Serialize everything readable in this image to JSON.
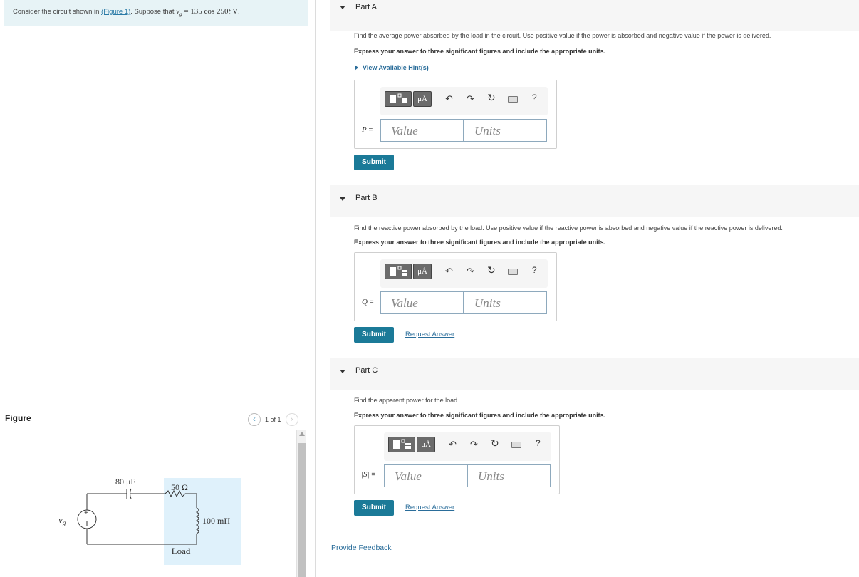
{
  "problem": {
    "prefix": "Consider the circuit shown in ",
    "figure_link": "(Figure 1)",
    "middle": ". Suppose that ",
    "equation": "v_g = 135 cos 250t V",
    "suffix": "."
  },
  "figure": {
    "label": "Figure",
    "pager_text": "1 of 1",
    "circuit": {
      "capacitor": "80 μF",
      "resistor": "50 Ω",
      "inductor": "100 mH",
      "load": "Load",
      "source": "v_g"
    }
  },
  "parts": [
    {
      "title": "Part A",
      "question": "Find the average power absorbed by the load in the circuit. Use positive value if the power is absorbed and negative value if the power is delivered.",
      "instruction": "Express your answer to three significant figures and include the appropriate units.",
      "hint_label": "View Available Hint(s)",
      "variable": "P",
      "value_placeholder": "Value",
      "units_placeholder": "Units",
      "submit_label": "Submit"
    },
    {
      "title": "Part B",
      "question": "Find the reactive power absorbed by the load. Use positive value if the reactive power is absorbed and negative value if the reactive power is delivered.",
      "instruction": "Express your answer to three significant figures and include the appropriate units.",
      "variable": "Q",
      "value_placeholder": "Value",
      "units_placeholder": "Units",
      "submit_label": "Submit",
      "request_label": "Request Answer"
    },
    {
      "title": "Part C",
      "question": "Find the apparent power for the load.",
      "instruction": "Express your answer to three significant figures and include the appropriate units.",
      "variable": "|S|",
      "value_placeholder": "Value",
      "units_placeholder": "Units",
      "submit_label": "Submit",
      "request_label": "Request Answer"
    }
  ],
  "toolbar": {
    "units_button": "μÅ",
    "help": "?"
  },
  "feedback_label": "Provide Feedback"
}
